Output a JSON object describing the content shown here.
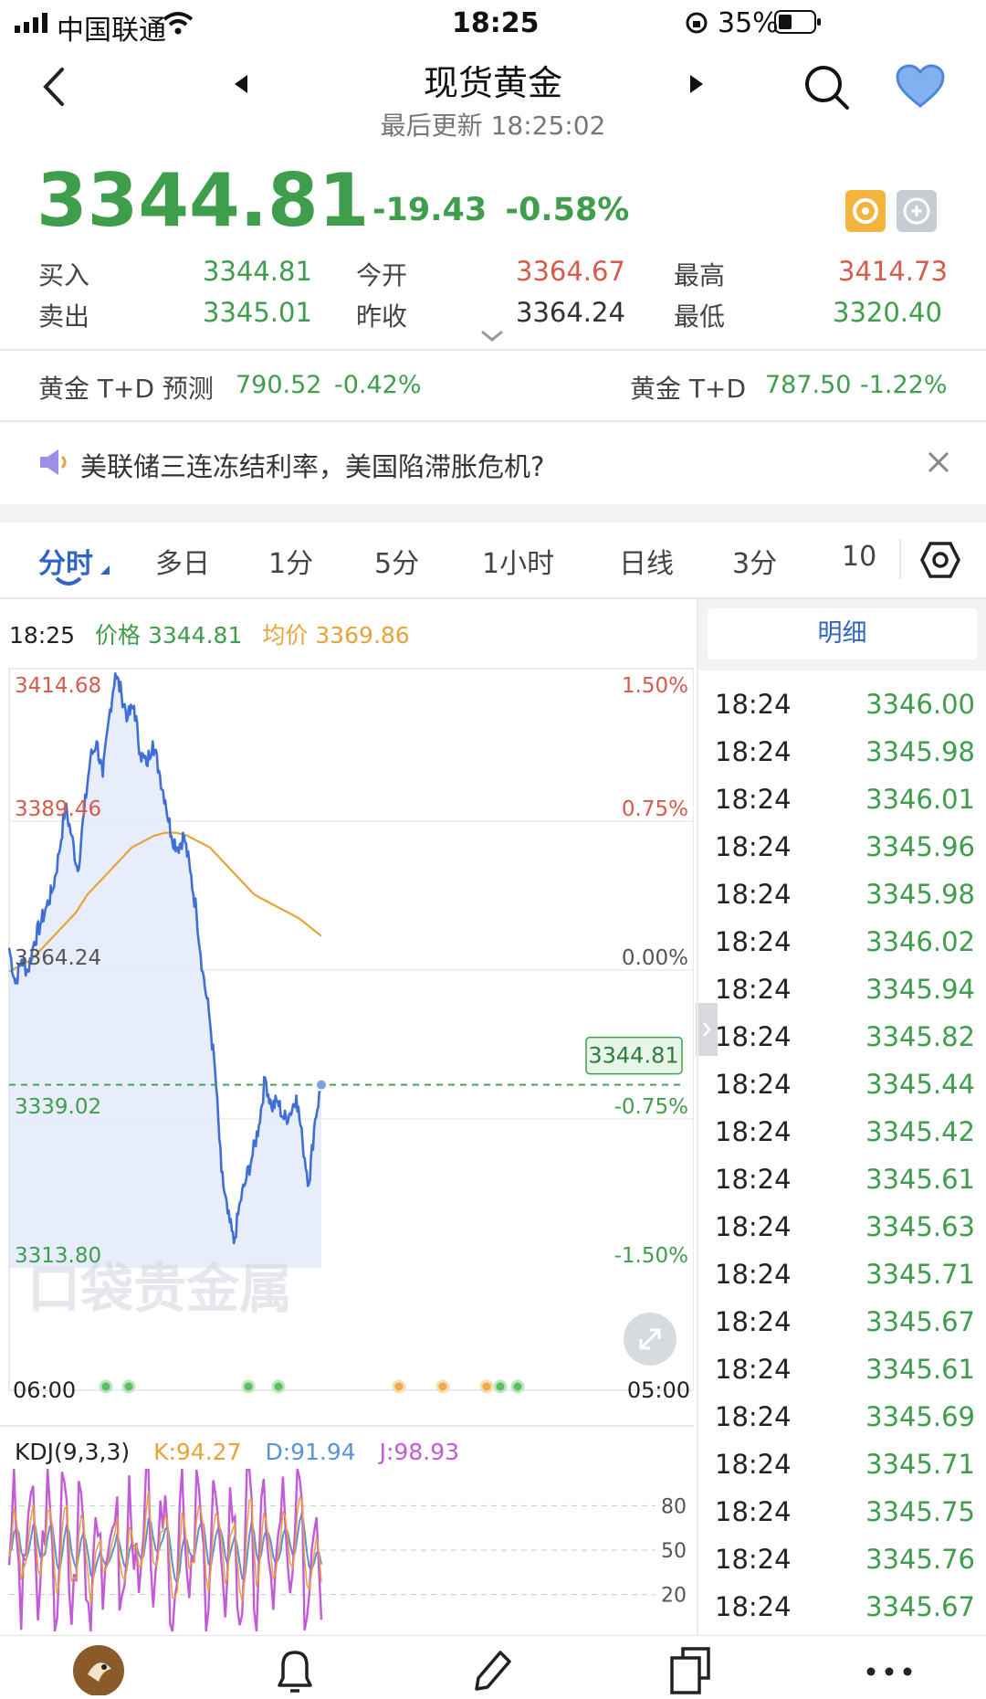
{
  "status_bar": {
    "carrier": "中国联通",
    "time": "18:25",
    "battery": "35%"
  },
  "header": {
    "title": "现货黄金",
    "subtitle": "最后更新 18:25:02"
  },
  "quote": {
    "price": "3344.81",
    "change": "-19.43",
    "change_pct": "-0.58%",
    "fields": [
      {
        "label": "买入",
        "value": "3344.81",
        "color": "green"
      },
      {
        "label": "卖出",
        "value": "3345.01",
        "color": "green"
      },
      {
        "label": "今开",
        "value": "3364.67",
        "color": "red"
      },
      {
        "label": "昨收",
        "value": "3364.24",
        "color": "dark"
      },
      {
        "label": "最高",
        "value": "3414.73",
        "color": "red"
      },
      {
        "label": "最低",
        "value": "3320.40",
        "color": "green"
      }
    ]
  },
  "related": [
    {
      "name": "黄金 T+D 预测",
      "value": "790.52",
      "pct": "-0.42%"
    },
    {
      "name": "黄金 T+D",
      "value": "787.50",
      "pct": "-1.22%"
    }
  ],
  "news": {
    "text": "美联储三连冻结利率，美国陷滞胀危机?"
  },
  "tabs": [
    "分时",
    "多日",
    "1分",
    "5分",
    "1小时",
    "日线",
    "3分",
    "10"
  ],
  "active_tab": 0,
  "chart_info": {
    "time": "18:25",
    "price_label": "价格",
    "price": "3344.81",
    "avg_label": "均价",
    "avg": "3369.86"
  },
  "chart_data": {
    "type": "line",
    "y_left_labels": [
      "3414.68",
      "3389.46",
      "3364.24",
      "3339.02",
      "3313.80"
    ],
    "y_right_labels": [
      "1.50%",
      "0.75%",
      "0.00%",
      "-0.75%",
      "-1.50%"
    ],
    "x_labels": [
      "06:00",
      "05:00"
    ],
    "ylim": [
      3313.8,
      3414.68
    ],
    "current_price_tag": "3344.81",
    "watermark": "口袋贵金属",
    "series": [
      {
        "name": "价格",
        "color": "#3f6fd6",
        "values": [
          3368,
          3362,
          3366,
          3364,
          3369,
          3372,
          3375,
          3378,
          3384,
          3392,
          3387,
          3381,
          3391,
          3400,
          3403,
          3397,
          3407,
          3414.5,
          3411,
          3407,
          3409,
          3401,
          3399,
          3403,
          3398,
          3393,
          3387,
          3385,
          3387,
          3381,
          3374,
          3364,
          3357,
          3347,
          3330,
          3323,
          3318,
          3325,
          3329,
          3333,
          3338,
          3346,
          3341,
          3342,
          3339,
          3340,
          3343,
          3335,
          3328,
          3339,
          3344.81
        ]
      },
      {
        "name": "均价",
        "color": "#e8a23a",
        "values": [
          3364,
          3365,
          3366,
          3368,
          3370,
          3372,
          3374,
          3377,
          3379,
          3381,
          3383,
          3385,
          3386,
          3387,
          3387.5,
          3387.5,
          3387,
          3386,
          3385,
          3383,
          3381,
          3379,
          3377,
          3376,
          3375,
          3374,
          3373,
          3371.5,
          3370
        ]
      }
    ]
  },
  "kdj": {
    "title": "KDJ(9,3,3)",
    "k": "K:94.27",
    "d": "D:91.94",
    "j": "J:98.93",
    "levels": [
      "80",
      "50",
      "20"
    ]
  },
  "details": {
    "header": "明细",
    "rows": [
      {
        "time": "18:24",
        "price": "3346.00"
      },
      {
        "time": "18:24",
        "price": "3345.98"
      },
      {
        "time": "18:24",
        "price": "3346.01"
      },
      {
        "time": "18:24",
        "price": "3345.96"
      },
      {
        "time": "18:24",
        "price": "3345.98"
      },
      {
        "time": "18:24",
        "price": "3346.02"
      },
      {
        "time": "18:24",
        "price": "3345.94"
      },
      {
        "time": "18:24",
        "price": "3345.82"
      },
      {
        "time": "18:24",
        "price": "3345.44"
      },
      {
        "time": "18:24",
        "price": "3345.42"
      },
      {
        "time": "18:24",
        "price": "3345.61"
      },
      {
        "time": "18:24",
        "price": "3345.63"
      },
      {
        "time": "18:24",
        "price": "3345.71"
      },
      {
        "time": "18:24",
        "price": "3345.67"
      },
      {
        "time": "18:24",
        "price": "3345.61"
      },
      {
        "time": "18:24",
        "price": "3345.69"
      },
      {
        "time": "18:24",
        "price": "3345.71"
      },
      {
        "time": "18:24",
        "price": "3345.75"
      },
      {
        "time": "18:24",
        "price": "3345.76"
      },
      {
        "time": "18:24",
        "price": "3345.67"
      }
    ]
  },
  "bottom_nav": [
    "home-eagle-icon",
    "bell-icon",
    "pencil-icon",
    "square-icon",
    "more-icon"
  ]
}
